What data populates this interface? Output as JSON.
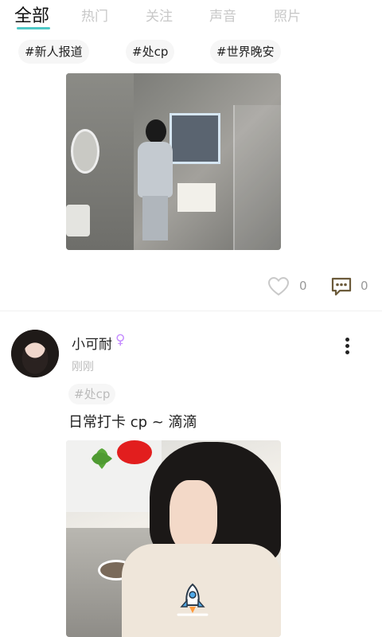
{
  "tabs": [
    {
      "label": "全部"
    },
    {
      "label": "热门"
    },
    {
      "label": "关注"
    },
    {
      "label": "声音"
    },
    {
      "label": "照片"
    }
  ],
  "hashtags": [
    {
      "label": "#新人报道"
    },
    {
      "label": "#处cp"
    },
    {
      "label": "#世界晚安"
    }
  ],
  "post1": {
    "likes": "0",
    "comments": "0"
  },
  "post2": {
    "username": "小可耐",
    "gender_symbol": "♀",
    "timestamp": "刚刚",
    "tag": "#处cp",
    "text": "日常打卡 cp ~ 滴滴",
    "likes": "",
    "comments": ""
  },
  "colors": {
    "accent": "#4fc8c6",
    "tab_inactive": "#c8c8c8",
    "gender": "#c58cff",
    "comment_icon": "#6b5a3a"
  },
  "icons": {
    "like": "heart-outline-icon",
    "comment": "chat-bubble-icon",
    "more": "vertical-dots-icon",
    "floating": "rocket-icon"
  }
}
